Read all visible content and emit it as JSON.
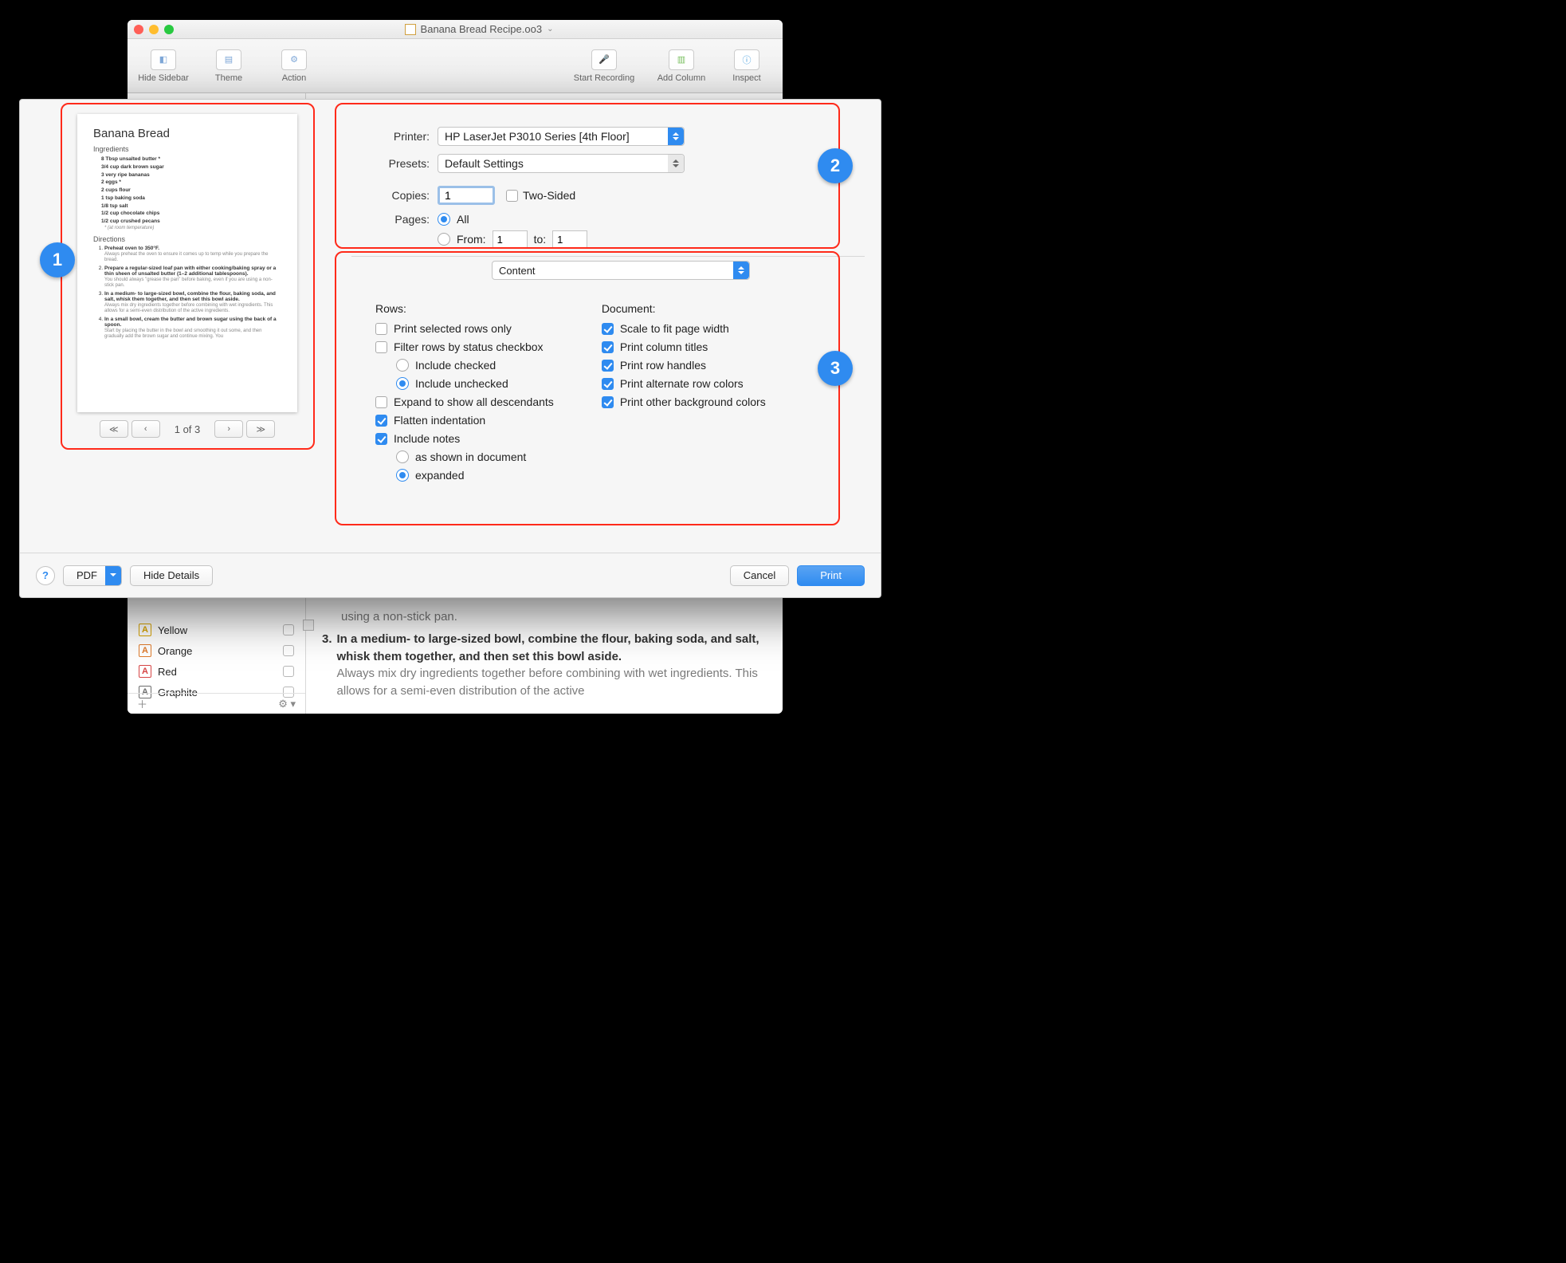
{
  "window": {
    "title": "Banana Bread Recipe.oo3",
    "toolbar": {
      "hide_sidebar": "Hide Sidebar",
      "theme": "Theme",
      "action": "Action",
      "start_recording": "Start Recording",
      "add_column": "Add Column",
      "inspect": "Inspect"
    }
  },
  "sidebar": {
    "items": [
      {
        "label": "Yellow",
        "color": "#d9a400"
      },
      {
        "label": "Orange",
        "color": "#e07b2c"
      },
      {
        "label": "Red",
        "color": "#d64545"
      },
      {
        "label": "Graphite",
        "color": "#6d6d6d"
      }
    ]
  },
  "content": {
    "top_partial": "using a non-stick pan.",
    "num": "3.",
    "title": "In a medium- to large-sized bowl, combine the flour, baking soda, and salt, whisk them together, and then set this bowl aside.",
    "sub": "Always mix dry ingredients together before combining with wet ingredients. This allows for a semi-even distribution of the active"
  },
  "dialog": {
    "preview": {
      "title": "Banana Bread",
      "ingredients_header": "Ingredients",
      "ingredients": [
        "8 Tbsp unsalted butter *",
        "3/4 cup dark brown sugar",
        "3 very ripe bananas",
        "2 eggs *",
        "2 cups flour",
        "1 tsp baking soda",
        "1/8 tsp salt",
        "1/2 cup chocolate chips",
        "1/2 cup crushed pecans"
      ],
      "ingredient_note": "* (at room temperature)",
      "directions_header": "Directions",
      "directions": [
        {
          "b": "Preheat oven to 350°F.",
          "s": "Always preheat the oven to ensure it comes up to temp while you prepare the bread."
        },
        {
          "b": "Prepare a regular-sized loaf pan with either cooking/baking spray or a thin sheen of unsalted butter (1–2 additional tablespoons).",
          "s": "You should always \"grease the pan\" before baking, even if you are using a non-stick pan."
        },
        {
          "b": "In a medium- to large-sized bowl, combine the flour, baking soda, and salt, whisk them together, and then set this bowl aside.",
          "s": "Always mix dry ingredients together before combining with wet ingredients. This allows for a semi-even distribution of the active ingredients."
        },
        {
          "b": "In a small bowl, cream the butter and brown sugar using the back of a spoon.",
          "s": "Start by placing the butter in the bowl and smoothing it out some, and then gradually add the brown sugar and continue mixing. You"
        }
      ],
      "pager": "1 of 3"
    },
    "printer_label": "Printer:",
    "printer_value": "HP LaserJet P3010 Series [4th Floor]",
    "presets_label": "Presets:",
    "presets_value": "Default Settings",
    "copies_label": "Copies:",
    "copies_value": "1",
    "two_sided": "Two-Sided",
    "pages_label": "Pages:",
    "pages_all": "All",
    "pages_from": "From:",
    "pages_from_val": "1",
    "pages_to": "to:",
    "pages_to_val": "1",
    "content_select": "Content",
    "rows": {
      "header": "Rows:",
      "print_selected": "Print selected rows only",
      "filter_status": "Filter rows by status checkbox",
      "include_checked": "Include checked",
      "include_unchecked": "Include unchecked",
      "expand_desc": "Expand to show all descendants",
      "flatten": "Flatten indentation",
      "include_notes": "Include notes",
      "as_shown": "as shown in document",
      "expanded": "expanded"
    },
    "document": {
      "header": "Document:",
      "scale": "Scale to fit page width",
      "col_titles": "Print column titles",
      "row_handles": "Print row handles",
      "alt_colors": "Print alternate row colors",
      "bg_colors": "Print other background colors"
    },
    "footer": {
      "pdf": "PDF",
      "hide_details": "Hide Details",
      "cancel": "Cancel",
      "print": "Print"
    }
  },
  "badges": {
    "b1": "1",
    "b2": "2",
    "b3": "3"
  }
}
